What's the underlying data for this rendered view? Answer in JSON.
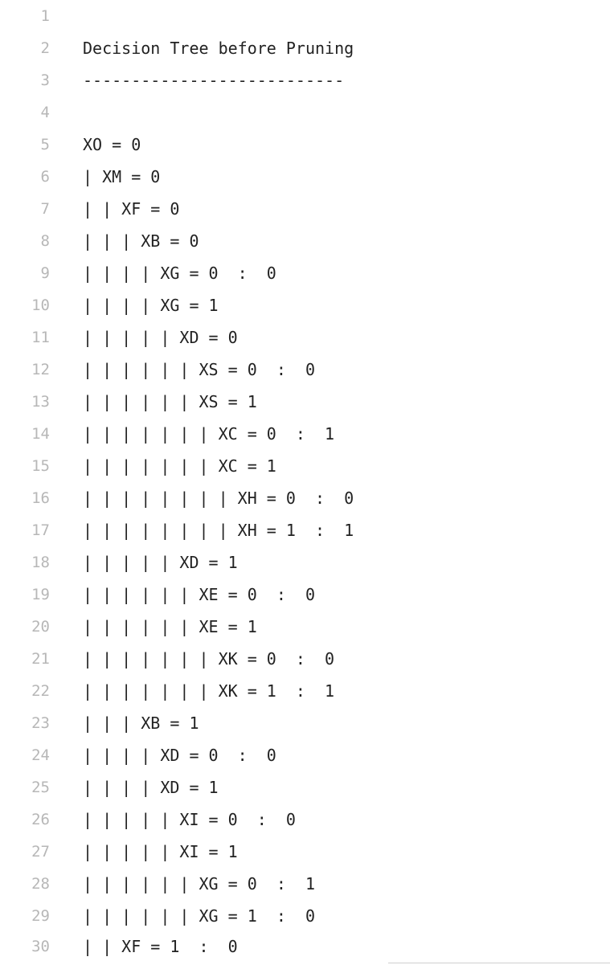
{
  "editor": {
    "lines": [
      {
        "number": "1",
        "text": ""
      },
      {
        "number": "2",
        "text": "Decision Tree before Pruning"
      },
      {
        "number": "3",
        "text": "---------------------------"
      },
      {
        "number": "4",
        "text": ""
      },
      {
        "number": "5",
        "text": "XO = 0"
      },
      {
        "number": "6",
        "text": "| XM = 0"
      },
      {
        "number": "7",
        "text": "| | XF = 0"
      },
      {
        "number": "8",
        "text": "| | | XB = 0"
      },
      {
        "number": "9",
        "text": "| | | | XG = 0  :  0"
      },
      {
        "number": "10",
        "text": "| | | | XG = 1"
      },
      {
        "number": "11",
        "text": "| | | | | XD = 0"
      },
      {
        "number": "12",
        "text": "| | | | | | XS = 0  :  0"
      },
      {
        "number": "13",
        "text": "| | | | | | XS = 1"
      },
      {
        "number": "14",
        "text": "| | | | | | | XC = 0  :  1"
      },
      {
        "number": "15",
        "text": "| | | | | | | XC = 1"
      },
      {
        "number": "16",
        "text": "| | | | | | | | XH = 0  :  0"
      },
      {
        "number": "17",
        "text": "| | | | | | | | XH = 1  :  1"
      },
      {
        "number": "18",
        "text": "| | | | | XD = 1"
      },
      {
        "number": "19",
        "text": "| | | | | | XE = 0  :  0"
      },
      {
        "number": "20",
        "text": "| | | | | | XE = 1"
      },
      {
        "number": "21",
        "text": "| | | | | | | XK = 0  :  0"
      },
      {
        "number": "22",
        "text": "| | | | | | | XK = 1  :  1"
      },
      {
        "number": "23",
        "text": "| | | XB = 1"
      },
      {
        "number": "24",
        "text": "| | | | XD = 0  :  0"
      },
      {
        "number": "25",
        "text": "| | | | XD = 1"
      },
      {
        "number": "26",
        "text": "| | | | | XI = 0  :  0"
      },
      {
        "number": "27",
        "text": "| | | | | XI = 1"
      },
      {
        "number": "28",
        "text": "| | | | | | XG = 0  :  1"
      },
      {
        "number": "29",
        "text": "| | | | | | XG = 1  :  0"
      },
      {
        "number": "30",
        "text": "| | XF = 1  :  0"
      }
    ]
  }
}
